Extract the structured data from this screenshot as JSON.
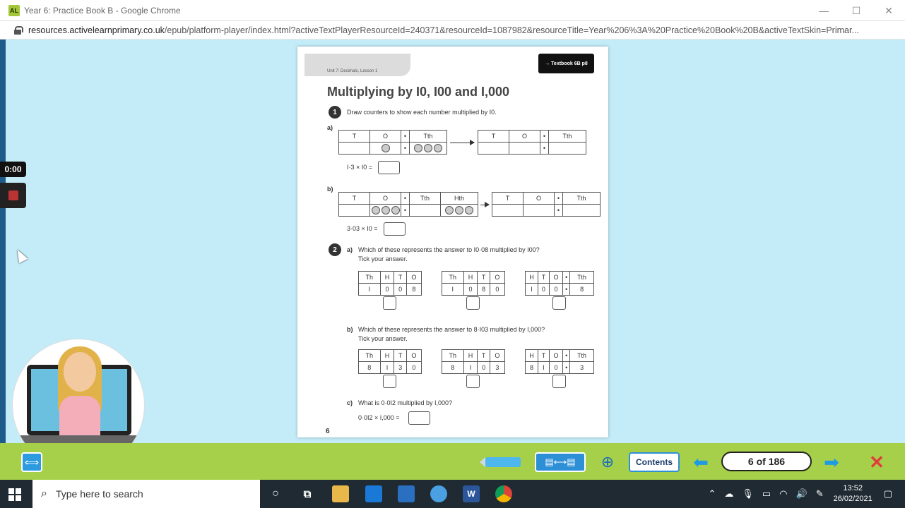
{
  "window": {
    "logo": "AL",
    "title": "Year 6: Practice Book B - Google Chrome",
    "minimize": "—",
    "maximize": "☐",
    "close": "✕"
  },
  "address": {
    "domain": "resources.activelearnprimary.co.uk",
    "path": "/epub/platform-player/index.html?activeTextPlayerResourceId=240371&resourceId=1087982&resourceTitle=Year%206%3A%20Practice%20Book%20B&activeTextSkin=Primar..."
  },
  "recorder": {
    "time": "0:00"
  },
  "page": {
    "unit": "Unit 7: Decimals, Lesson 1",
    "textbook": "→ Textbook 6B p8",
    "title": "Multiplying by I0, I00 and I,000",
    "q1": {
      "num": "1",
      "text": "Draw counters to show each number multiplied by I0.",
      "a_label": "a)",
      "a_headers": [
        "T",
        "O",
        "•",
        "Tth"
      ],
      "a_eq": "I·3 × I0 =",
      "b_label": "b)",
      "b_headers": [
        "T",
        "O",
        "•",
        "Tth",
        "Hth"
      ],
      "b_eq": "3·03 × I0 =",
      "dot": "•"
    },
    "q2": {
      "num": "2",
      "a_label": "a)",
      "a_text1": "Which of these represents the answer to I0·08 multiplied by I00?",
      "a_text2": "Tick your answer.",
      "a_opt1_h": [
        "Th",
        "H",
        "T",
        "O"
      ],
      "a_opt1_v": [
        "I",
        "0",
        "0",
        "8"
      ],
      "a_opt2_h": [
        "Th",
        "H",
        "T",
        "O"
      ],
      "a_opt2_v": [
        "I",
        "0",
        "8",
        "0"
      ],
      "a_opt3_h": [
        "H",
        "T",
        "O",
        "•",
        "Tth"
      ],
      "a_opt3_v": [
        "I",
        "0",
        "0",
        "•",
        "8"
      ],
      "b_label": "b)",
      "b_text1": "Which of these represents the answer to 8·I03 multiplied by I,000?",
      "b_text2": "Tick your answer.",
      "b_opt1_h": [
        "Th",
        "H",
        "T",
        "O"
      ],
      "b_opt1_v": [
        "8",
        "I",
        "3",
        "0"
      ],
      "b_opt2_h": [
        "Th",
        "H",
        "T",
        "O"
      ],
      "b_opt2_v": [
        "8",
        "I",
        "0",
        "3"
      ],
      "b_opt3_h": [
        "H",
        "T",
        "O",
        "•",
        "Tth"
      ],
      "b_opt3_v": [
        "8",
        "I",
        "0",
        "•",
        "3"
      ],
      "c_label": "c)",
      "c_text": "What is 0·0I2 multiplied by I,000?",
      "c_eq": "0·0I2 × I,000 ="
    },
    "page_number": "6"
  },
  "toolbar": {
    "expand_icon": "⟺",
    "view_icon": "▤⟷▤",
    "zoom_icon": "⊕",
    "contents": "Contents",
    "prev_icon": "⬅",
    "page_indicator": "6 of 186",
    "next_icon": "➡",
    "close_icon": "✕"
  },
  "taskbar": {
    "search_placeholder": "Type here to search",
    "cortana_icon": "○",
    "taskview_icon": "⧉",
    "icons": [
      "explorer",
      "mail",
      "store",
      "webex",
      "word",
      "chrome"
    ],
    "time": "13:52",
    "date": "26/02/2021"
  }
}
